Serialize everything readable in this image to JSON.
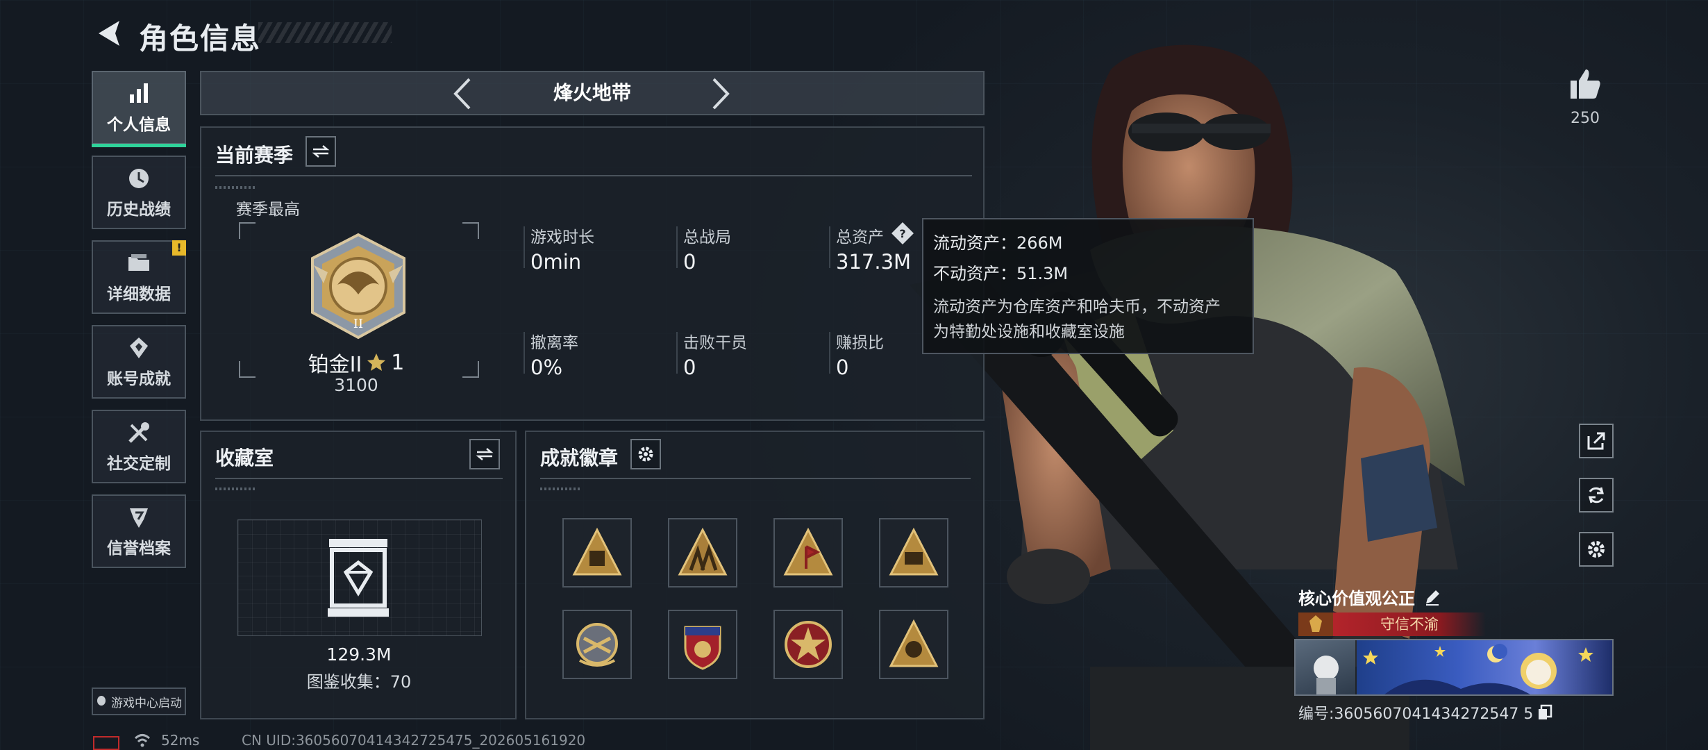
{
  "header": {
    "title": "角色信息"
  },
  "nav": {
    "items": [
      {
        "label": "个人信息",
        "icon": "bar-chart-icon",
        "active": true
      },
      {
        "label": "历史战绩",
        "icon": "history-icon"
      },
      {
        "label": "详细数据",
        "icon": "folder-icon",
        "badge": "!"
      },
      {
        "label": "账号成就",
        "icon": "achievement-icon"
      },
      {
        "label": "社交定制",
        "icon": "tools-icon"
      },
      {
        "label": "信誉档案",
        "icon": "credit-icon"
      }
    ],
    "game_center": "游戏中心启动"
  },
  "mode": {
    "label": "烽火地带"
  },
  "season": {
    "title": "当前赛季",
    "best_label": "赛季最高",
    "rank_name": "铂金II",
    "rank_stars": "1",
    "rank_score": "3100",
    "stats": [
      {
        "label": "游戏时长",
        "value": "0min"
      },
      {
        "label": "总战局",
        "value": "0"
      },
      {
        "label": "总资产",
        "value": "317.3M"
      },
      {
        "label": "撤离率",
        "value": "0%"
      },
      {
        "label": "击败干员",
        "value": "0"
      },
      {
        "label": "赚损比",
        "value": "0"
      }
    ]
  },
  "tooltip": {
    "liquid": "流动资产：266M",
    "fixed": "不动资产：51.3M",
    "desc_line1": "流动资产为仓库资产和哈夫币，不动资产",
    "desc_line2": "为特勤处设施和收藏室设施"
  },
  "collection": {
    "title": "收藏室",
    "value": "129.3M",
    "catalog": "图鉴收集：70"
  },
  "achievements": {
    "title": "成就徽章",
    "count": 8
  },
  "right": {
    "likes": "250",
    "core_value": "核心价值观公正",
    "motto": "守信不渝",
    "id_line": "编号:3605607041434272547 5"
  },
  "footer": {
    "ping": "52ms",
    "uid": "CN UID:36056070414342725475_202605161920"
  },
  "colors": {
    "accent_green": "#2fd39a",
    "badge_yellow": "#e7b82a",
    "motto_red": "#b3242b",
    "gold": "#c9a35a"
  }
}
